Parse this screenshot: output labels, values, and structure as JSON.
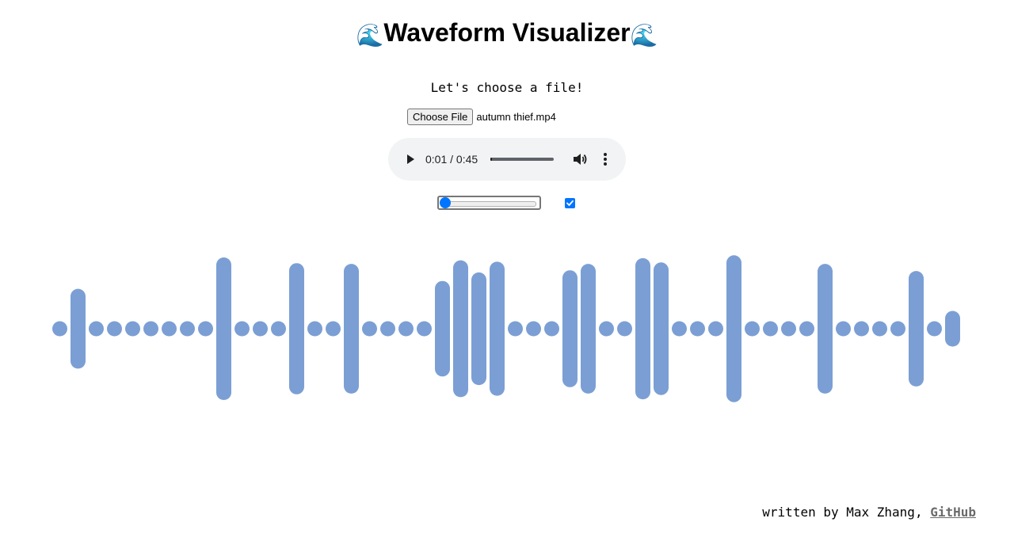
{
  "header": {
    "title": "Waveform Visualizer",
    "emoji": "🌊"
  },
  "upload": {
    "prompt": "Let's choose a file!",
    "button_label": "Choose File",
    "file_name": "autumn thief.mp4"
  },
  "audio_player": {
    "time": "0:01 / 0:45",
    "progress": 0.022,
    "play_icon": "play-icon",
    "volume_icon": "volume-icon",
    "more_icon": "more-options-icon",
    "background_color": "#f1f3f4"
  },
  "controls": {
    "slider_value": 0,
    "checkbox_checked": true,
    "accent_color": "#0075ff"
  },
  "waveform": {
    "bar_color": "#7b9fd4",
    "levels": [
      0.09,
      0.56,
      0.09,
      0.09,
      0.09,
      0.09,
      0.09,
      0.09,
      0.09,
      1.0,
      0.09,
      0.09,
      0.09,
      0.92,
      0.09,
      0.09,
      0.91,
      0.09,
      0.09,
      0.09,
      0.09,
      0.67,
      0.96,
      0.79,
      0.94,
      0.09,
      0.09,
      0.09,
      0.82,
      0.91,
      0.09,
      0.09,
      0.99,
      0.93,
      0.09,
      0.09,
      0.09,
      1.03,
      0.09,
      0.09,
      0.09,
      0.09,
      0.91,
      0.09,
      0.09,
      0.09,
      0.09,
      0.81,
      0.09,
      0.25
    ]
  },
  "footer": {
    "credit": "written by Max Zhang, ",
    "link_label": "GitHub"
  }
}
